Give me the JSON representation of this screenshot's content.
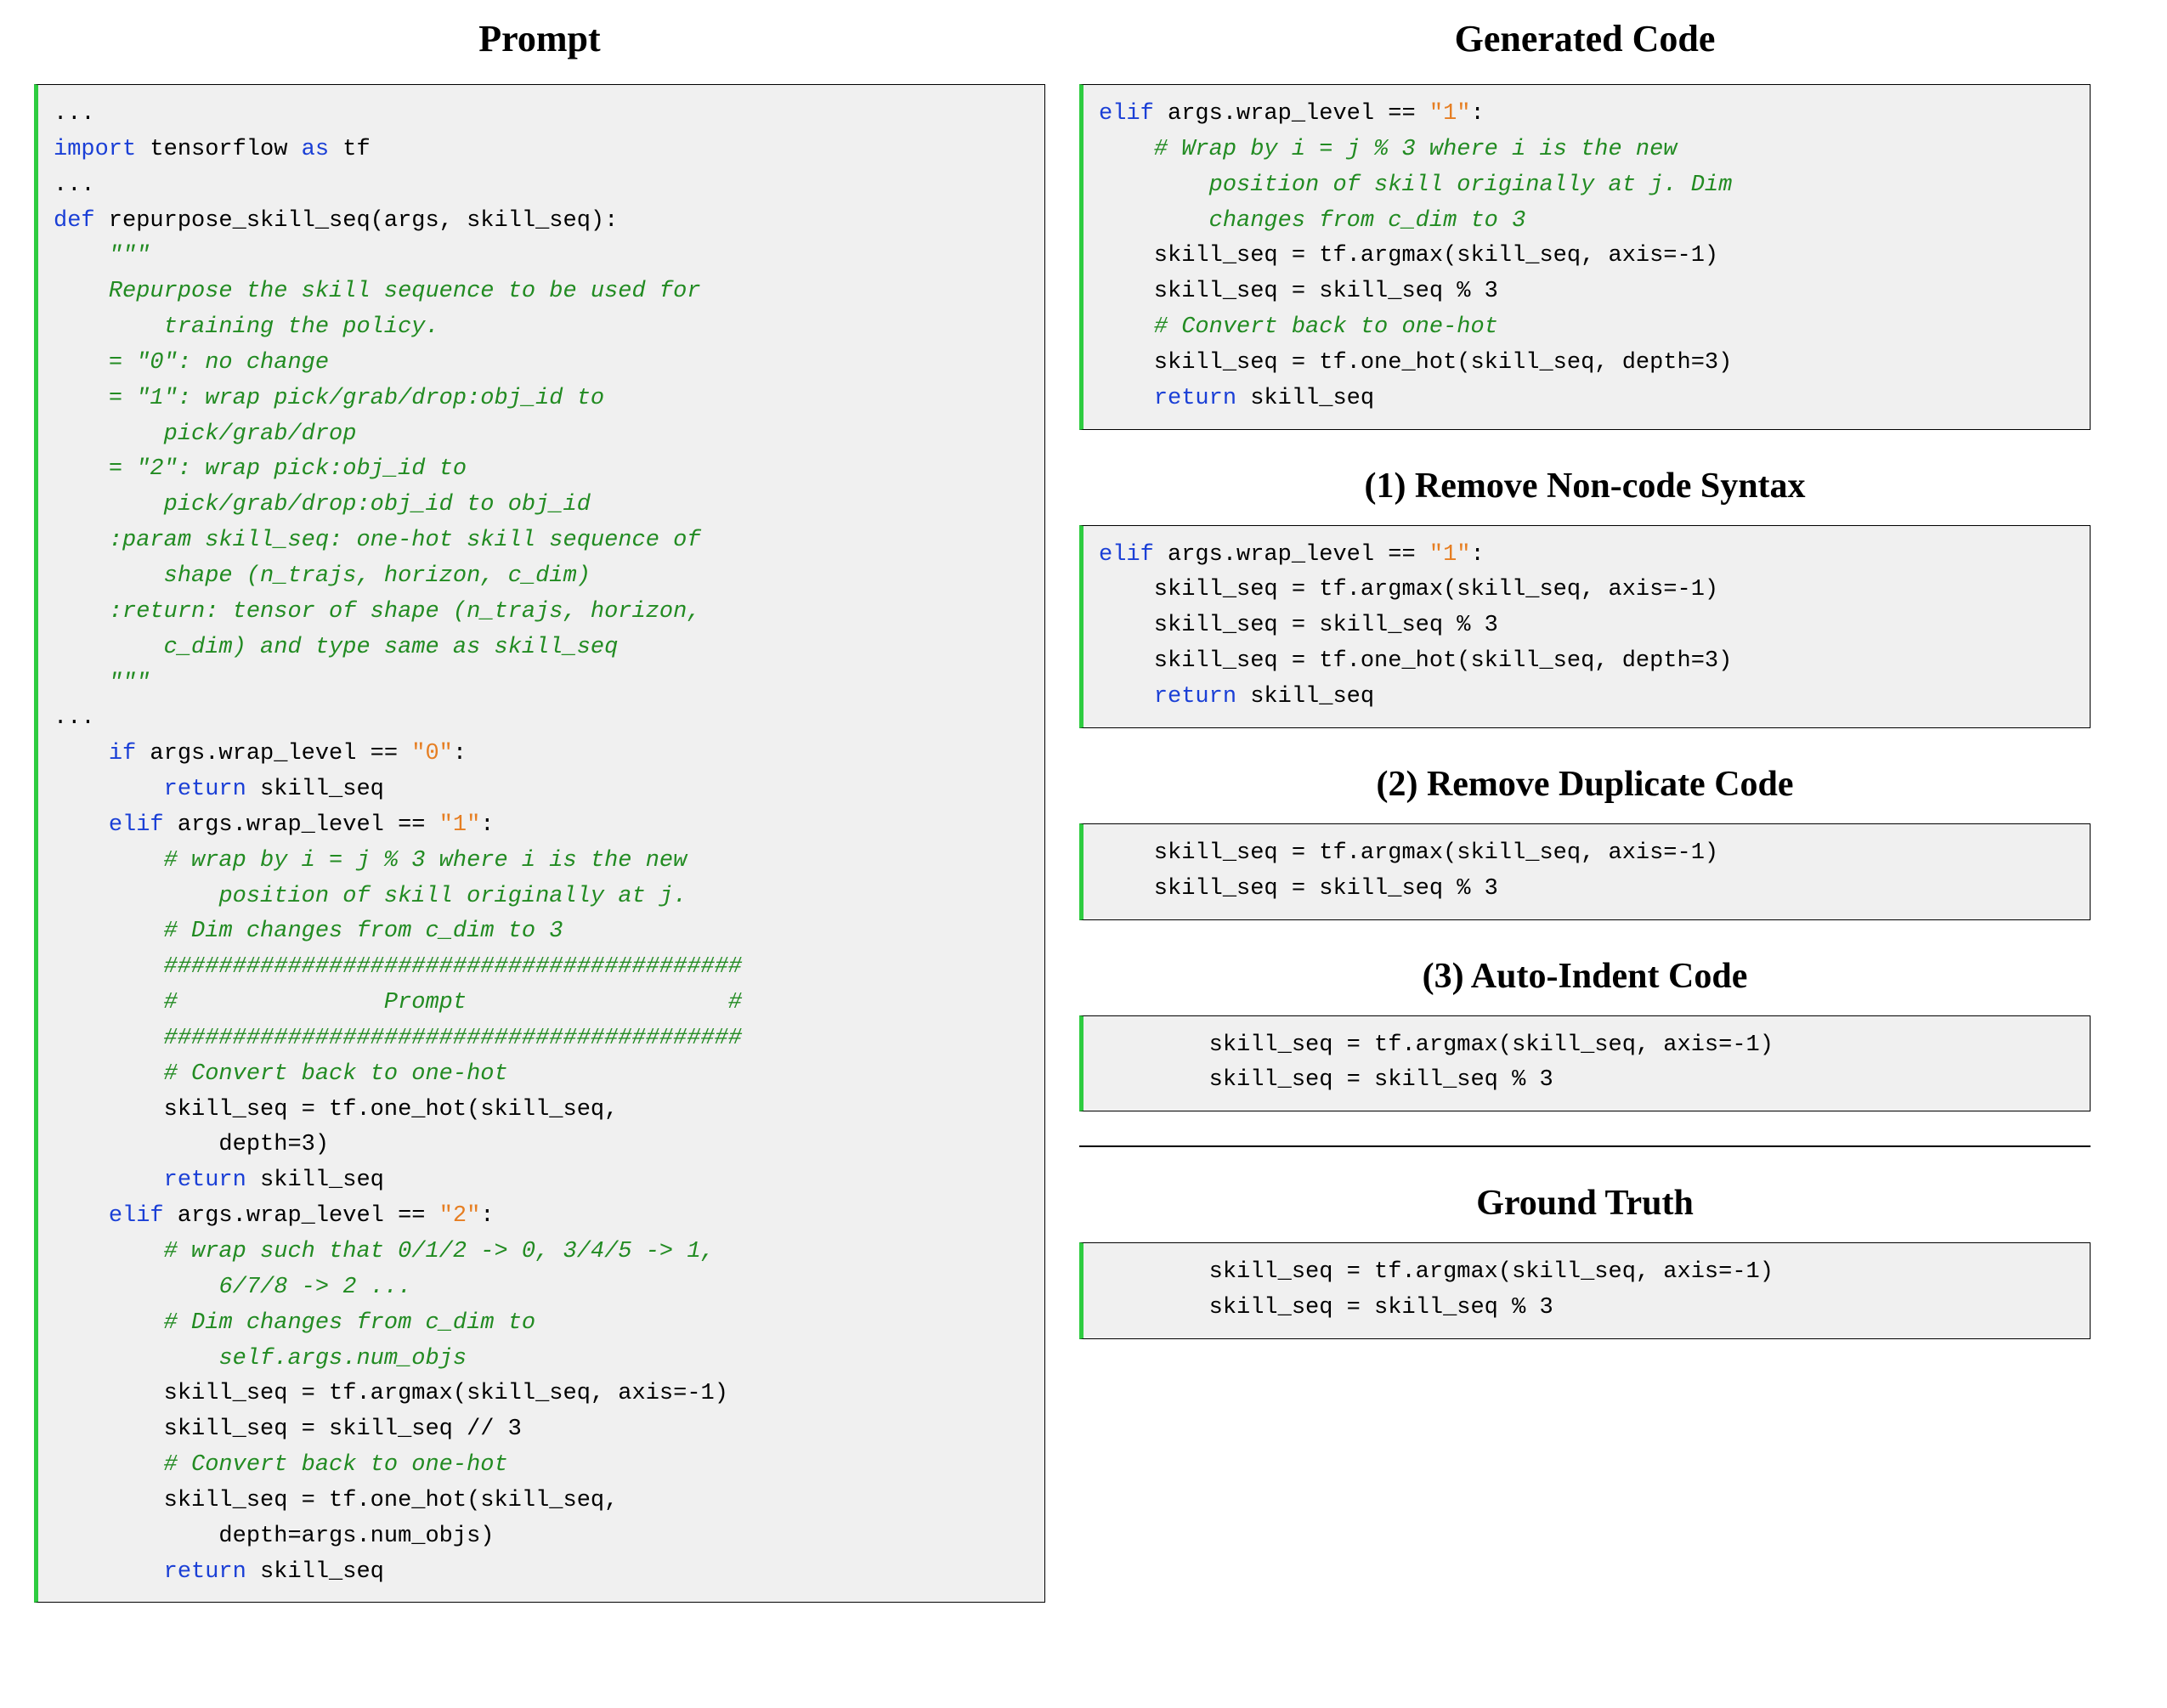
{
  "titles": {
    "prompt": "Prompt",
    "generated": "Generated Code",
    "step1": "(1) Remove Non-code Syntax",
    "step2": "(2) Remove Duplicate Code",
    "step3": "(3) Auto-Indent Code",
    "ground_truth": "Ground Truth"
  },
  "prompt_lines": [
    {
      "indent": 0,
      "parts": [
        {
          "t": "..."
        }
      ]
    },
    {
      "indent": 0,
      "parts": [
        {
          "t": "import",
          "c": "kw"
        },
        {
          "t": " tensorflow "
        },
        {
          "t": "as",
          "c": "kw"
        },
        {
          "t": " tf"
        }
      ]
    },
    {
      "indent": 0,
      "parts": [
        {
          "t": "..."
        }
      ]
    },
    {
      "indent": 0,
      "parts": [
        {
          "t": "def",
          "c": "kw"
        },
        {
          "t": " repurpose_skill_seq(args, skill_seq):"
        }
      ]
    },
    {
      "indent": 4,
      "parts": [
        {
          "t": "\"\"\"",
          "c": "docstr"
        }
      ]
    },
    {
      "indent": 4,
      "parts": [
        {
          "t": "Repurpose the skill sequence to be used for",
          "c": "docstr"
        }
      ]
    },
    {
      "indent": 8,
      "parts": [
        {
          "t": "training the policy.",
          "c": "docstr"
        }
      ]
    },
    {
      "indent": 4,
      "parts": [
        {
          "t": "= \"0\": no change",
          "c": "docstr"
        }
      ]
    },
    {
      "indent": 4,
      "parts": [
        {
          "t": "= \"1\": wrap pick/grab/drop:obj_id to",
          "c": "docstr"
        }
      ]
    },
    {
      "indent": 8,
      "parts": [
        {
          "t": "pick/grab/drop",
          "c": "docstr"
        }
      ]
    },
    {
      "indent": 4,
      "parts": [
        {
          "t": "= \"2\": wrap pick:obj_id to",
          "c": "docstr"
        }
      ]
    },
    {
      "indent": 8,
      "parts": [
        {
          "t": "pick/grab/drop:obj_id to obj_id",
          "c": "docstr"
        }
      ]
    },
    {
      "indent": 4,
      "parts": [
        {
          "t": ":param skill_seq: one-hot skill sequence of",
          "c": "docstr"
        }
      ]
    },
    {
      "indent": 8,
      "parts": [
        {
          "t": "shape (n_trajs, horizon, c_dim)",
          "c": "docstr"
        }
      ]
    },
    {
      "indent": 4,
      "parts": [
        {
          "t": ":return: tensor of shape (n_trajs, horizon,",
          "c": "docstr"
        }
      ]
    },
    {
      "indent": 8,
      "parts": [
        {
          "t": "c_dim) and type same as skill_seq",
          "c": "docstr"
        }
      ]
    },
    {
      "indent": 4,
      "parts": [
        {
          "t": "\"\"\"",
          "c": "docstr"
        }
      ]
    },
    {
      "indent": 0,
      "parts": [
        {
          "t": "..."
        }
      ]
    },
    {
      "indent": 4,
      "parts": [
        {
          "t": "if",
          "c": "kw"
        },
        {
          "t": " args.wrap_level == "
        },
        {
          "t": "\"0\"",
          "c": "str"
        },
        {
          "t": ":"
        }
      ]
    },
    {
      "indent": 8,
      "parts": [
        {
          "t": "return",
          "c": "kw"
        },
        {
          "t": " skill_seq"
        }
      ]
    },
    {
      "indent": 4,
      "parts": [
        {
          "t": "elif",
          "c": "kw"
        },
        {
          "t": " args.wrap_level == "
        },
        {
          "t": "\"1\"",
          "c": "str"
        },
        {
          "t": ":"
        }
      ]
    },
    {
      "indent": 8,
      "parts": [
        {
          "t": "# wrap by i = j % 3 where i is the new",
          "c": "com"
        }
      ]
    },
    {
      "indent": 12,
      "parts": [
        {
          "t": "position of skill originally at j.",
          "c": "com"
        }
      ]
    },
    {
      "indent": 8,
      "parts": [
        {
          "t": "# Dim changes from c_dim to 3",
          "c": "com"
        }
      ]
    },
    {
      "indent": 8,
      "parts": [
        {
          "t": "##########################################",
          "c": "com"
        }
      ]
    },
    {
      "indent": 8,
      "parts": [
        {
          "t": "#               Prompt                   #",
          "c": "com"
        }
      ]
    },
    {
      "indent": 8,
      "parts": [
        {
          "t": "##########################################",
          "c": "com"
        }
      ]
    },
    {
      "indent": 8,
      "parts": [
        {
          "t": "# Convert back to one-hot",
          "c": "com"
        }
      ]
    },
    {
      "indent": 8,
      "parts": [
        {
          "t": "skill_seq = tf.one_hot(skill_seq,"
        }
      ]
    },
    {
      "indent": 12,
      "parts": [
        {
          "t": "depth=3)"
        }
      ]
    },
    {
      "indent": 8,
      "parts": [
        {
          "t": "return",
          "c": "kw"
        },
        {
          "t": " skill_seq"
        }
      ]
    },
    {
      "indent": 4,
      "parts": [
        {
          "t": "elif",
          "c": "kw"
        },
        {
          "t": " args.wrap_level == "
        },
        {
          "t": "\"2\"",
          "c": "str"
        },
        {
          "t": ":"
        }
      ]
    },
    {
      "indent": 8,
      "parts": [
        {
          "t": "# wrap such that 0/1/2 -> 0, 3/4/5 -> 1,",
          "c": "com"
        }
      ]
    },
    {
      "indent": 12,
      "parts": [
        {
          "t": "6/7/8 -> 2 ...",
          "c": "com"
        }
      ]
    },
    {
      "indent": 8,
      "parts": [
        {
          "t": "# Dim changes from c_dim to",
          "c": "com"
        }
      ]
    },
    {
      "indent": 12,
      "parts": [
        {
          "t": "self.args.num_objs",
          "c": "com"
        }
      ]
    },
    {
      "indent": 8,
      "parts": [
        {
          "t": "skill_seq = tf.argmax(skill_seq, axis=-1)"
        }
      ]
    },
    {
      "indent": 8,
      "parts": [
        {
          "t": "skill_seq = skill_seq // 3"
        }
      ]
    },
    {
      "indent": 8,
      "parts": [
        {
          "t": "# Convert back to one-hot",
          "c": "com"
        }
      ]
    },
    {
      "indent": 8,
      "parts": [
        {
          "t": "skill_seq = tf.one_hot(skill_seq,"
        }
      ]
    },
    {
      "indent": 12,
      "parts": [
        {
          "t": "depth=args.num_objs)"
        }
      ]
    },
    {
      "indent": 8,
      "parts": [
        {
          "t": "return",
          "c": "kw"
        },
        {
          "t": " skill_seq"
        }
      ]
    }
  ],
  "generated_lines": [
    {
      "indent": 0,
      "parts": [
        {
          "t": "elif",
          "c": "kw"
        },
        {
          "t": " args.wrap_level == "
        },
        {
          "t": "\"1\"",
          "c": "str"
        },
        {
          "t": ":"
        }
      ]
    },
    {
      "indent": 4,
      "parts": [
        {
          "t": "# Wrap by i = j % 3 where i is the new",
          "c": "com"
        }
      ]
    },
    {
      "indent": 8,
      "parts": [
        {
          "t": "position of skill originally at j. Dim",
          "c": "com"
        }
      ]
    },
    {
      "indent": 8,
      "parts": [
        {
          "t": "changes from c_dim to 3",
          "c": "com"
        }
      ]
    },
    {
      "indent": 4,
      "parts": [
        {
          "t": "skill_seq = tf.argmax(skill_seq, axis=-1)"
        }
      ]
    },
    {
      "indent": 4,
      "parts": [
        {
          "t": "skill_seq = skill_seq % 3"
        }
      ]
    },
    {
      "indent": 4,
      "parts": [
        {
          "t": "# Convert back to one-hot",
          "c": "com"
        }
      ]
    },
    {
      "indent": 4,
      "parts": [
        {
          "t": "skill_seq = tf.one_hot(skill_seq, depth=3)"
        }
      ]
    },
    {
      "indent": 4,
      "parts": [
        {
          "t": "return",
          "c": "kw"
        },
        {
          "t": " skill_seq"
        }
      ]
    }
  ],
  "step1_lines": [
    {
      "indent": 0,
      "parts": [
        {
          "t": "elif",
          "c": "kw"
        },
        {
          "t": " args.wrap_level == "
        },
        {
          "t": "\"1\"",
          "c": "str"
        },
        {
          "t": ":"
        }
      ]
    },
    {
      "indent": 4,
      "parts": [
        {
          "t": "skill_seq = tf.argmax(skill_seq, axis=-1)"
        }
      ]
    },
    {
      "indent": 4,
      "parts": [
        {
          "t": "skill_seq = skill_seq % 3"
        }
      ]
    },
    {
      "indent": 4,
      "parts": [
        {
          "t": "skill_seq = tf.one_hot(skill_seq, depth=3)"
        }
      ]
    },
    {
      "indent": 4,
      "parts": [
        {
          "t": "return",
          "c": "kw"
        },
        {
          "t": " skill_seq"
        }
      ]
    }
  ],
  "step2_lines": [
    {
      "indent": 4,
      "parts": [
        {
          "t": "skill_seq = tf.argmax(skill_seq, axis=-1)"
        }
      ]
    },
    {
      "indent": 4,
      "parts": [
        {
          "t": "skill_seq = skill_seq % 3"
        }
      ]
    }
  ],
  "step3_lines": [
    {
      "indent": 8,
      "parts": [
        {
          "t": "skill_seq = tf.argmax(skill_seq, axis=-1)"
        }
      ]
    },
    {
      "indent": 8,
      "parts": [
        {
          "t": "skill_seq = skill_seq % 3"
        }
      ]
    }
  ],
  "ground_truth_lines": [
    {
      "indent": 8,
      "parts": [
        {
          "t": "skill_seq = tf.argmax(skill_seq, axis=-1)"
        }
      ]
    },
    {
      "indent": 8,
      "parts": [
        {
          "t": "skill_seq = skill_seq % 3"
        }
      ]
    }
  ]
}
